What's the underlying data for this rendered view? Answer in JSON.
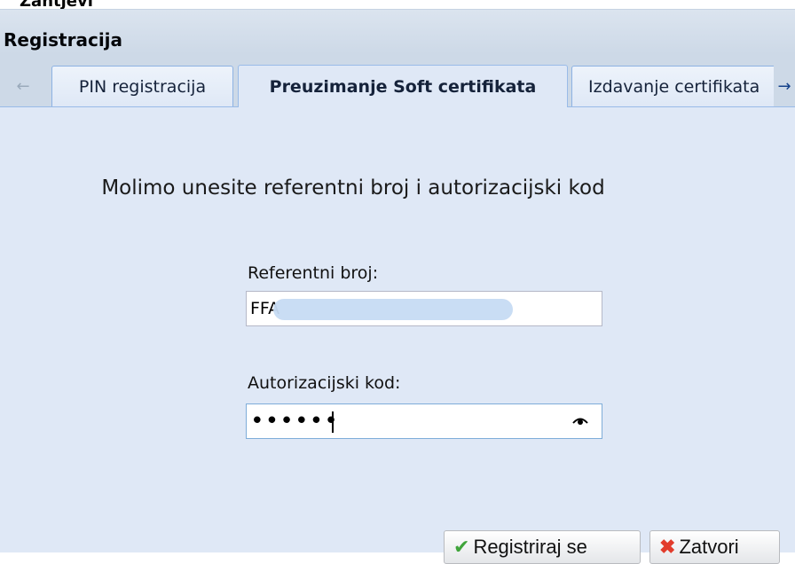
{
  "window": {
    "title": "Registracija",
    "peek_text": "Zahtjevi"
  },
  "tabs": [
    {
      "label": "PIN registracija",
      "active": false
    },
    {
      "label": "Preuzimanje Soft certifikata",
      "active": true
    },
    {
      "label": "Izdavanje certifikata",
      "active": false
    }
  ],
  "form": {
    "prompt": "Molimo unesite referentni broj i autorizacijski kod",
    "reference_label": "Referentni broj:",
    "reference_value": "FFA",
    "auth_label": "Autorizacijski kod:",
    "auth_masked": "••••••"
  },
  "buttons": {
    "register_label": "Registriraj se",
    "close_label": "Zatvori"
  },
  "icons": {
    "scroll_left": "arrow-left-icon",
    "scroll_right": "arrow-right-icon",
    "register": "checkmark-icon",
    "close": "close-icon",
    "reveal": "eye-icon"
  },
  "colors": {
    "panel_background": "#dfe8f6",
    "tab_border": "#99bbe8",
    "check_green": "#3fa43a",
    "close_red": "#e23c2c"
  }
}
